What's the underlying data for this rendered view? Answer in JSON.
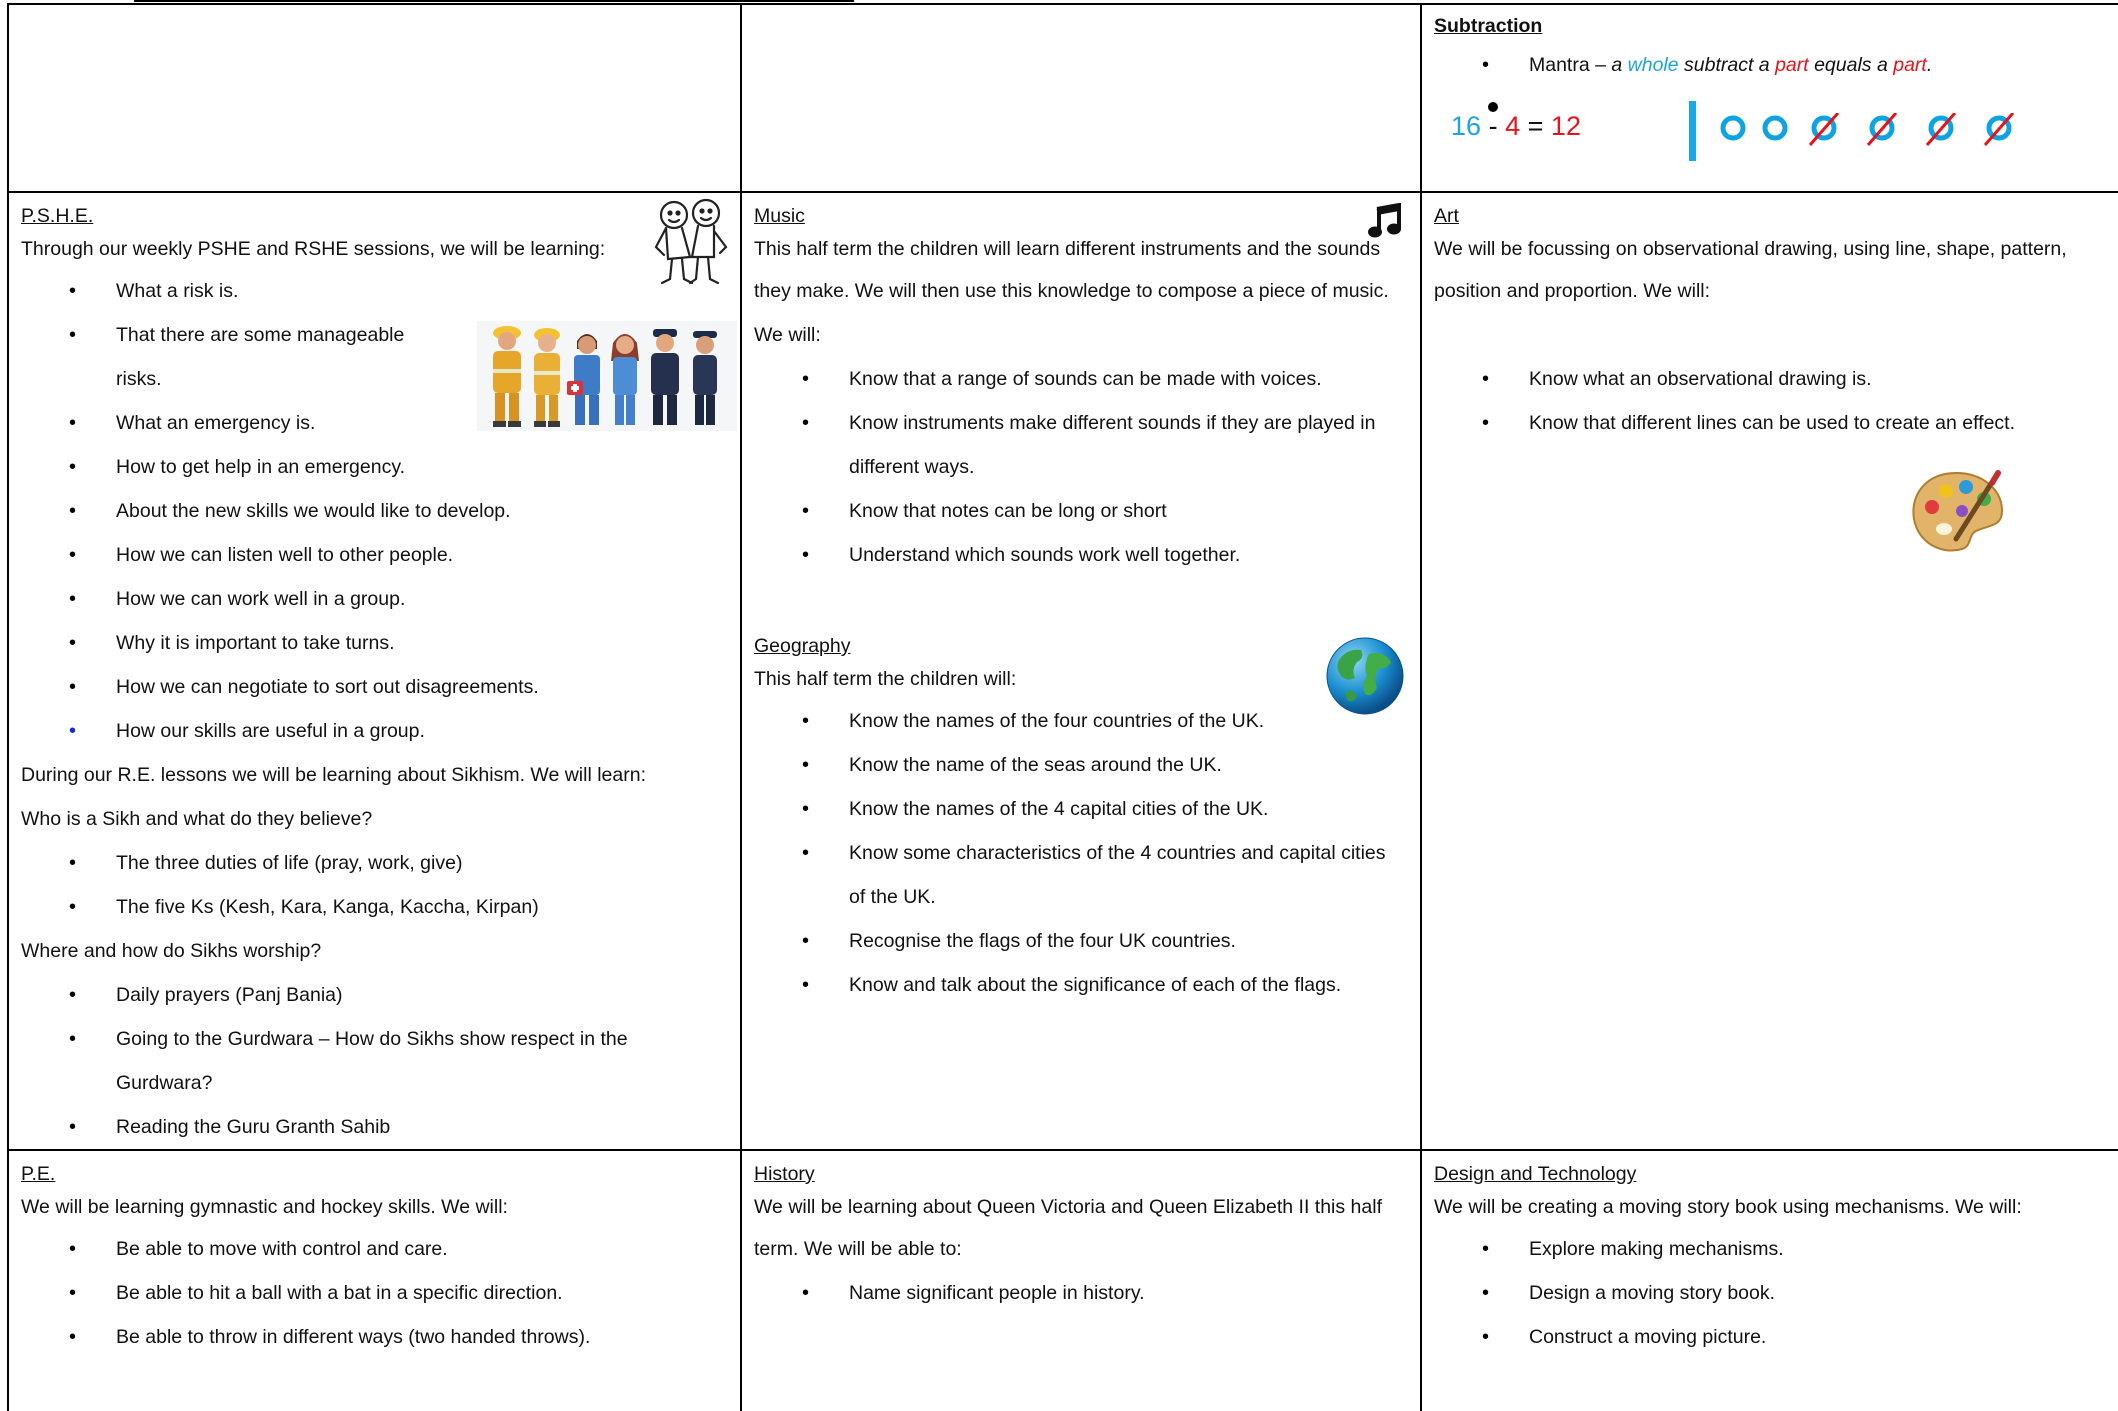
{
  "maths": {
    "title": "Subtraction",
    "mantra_prefix": "Mantra – ",
    "mantra_a": "a ",
    "mantra_whole": "whole",
    "mantra_subtract": " subtract a ",
    "mantra_part1": "part",
    "mantra_equals": " equals a ",
    "mantra_part2": "part",
    "mantra_end": ".",
    "eq_whole": "16",
    "eq_minus": "-",
    "eq_part": "4",
    "eq_equals": "=",
    "eq_result": "12",
    "colors": {
      "whole": "#1ba3dd",
      "part": "#e8131a",
      "bar": "#1aa7e6"
    },
    "model": {
      "kept": 2,
      "crossed": 4
    }
  },
  "pshe": {
    "title": "P.S.H.E.",
    "intro": "Through our weekly PSHE and RSHE sessions, we will be learning:",
    "items": [
      "What a risk is.",
      "That there are some manageable",
      "risks.",
      "What an emergency is.",
      "How to get help in an emergency.",
      "About the new skills we would like to develop.",
      "How we can listen well to other people.",
      "How we can work well in a group.",
      "Why it is important to take turns.",
      "How we can negotiate to sort out disagreements.",
      "How our skills are useful in a group."
    ],
    "re_intro": "During our R.E. lessons we will be learning about Sikhism. We will learn:",
    "q1": "Who is a Sikh and what do they believe?",
    "q1_items": [
      " The three duties of life (pray, work, give)",
      "The five Ks (Kesh, Kara, Kanga, Kaccha, Kirpan)"
    ],
    "q2": "Where and how do Sikhs worship?",
    "q2_items": [
      "Daily prayers (Panj Bania)",
      "Going to the Gurdwara – How do Sikhs show respect in the Gurdwara?",
      "Reading the Guru Granth Sahib"
    ],
    "icons": [
      "friends-drawing-icon",
      "helpers-illustration-icon"
    ]
  },
  "music": {
    "title": "Music",
    "intro1": "This half term the children will learn different instruments and the sounds",
    "intro2": "they make. We will then use this knowledge to compose a piece of music.",
    "intro3": "We will:",
    "items": [
      "Know that a range of sounds can be made with voices.",
      "Know instruments make different sounds if they are played in",
      "different ways.",
      "Know that notes can be long or short",
      "Understand which sounds work well together."
    ],
    "icon": "music-note-icon"
  },
  "geography": {
    "title": "Geography",
    "intro": "This half term the children will:",
    "items": [
      "Know the names of the four countries of the UK.",
      "Know the name of the seas around the UK.",
      "Know the names of the 4 capital cities of the UK.",
      "Know some characteristics of the 4 countries and capital cities",
      "of the UK.",
      "Recognise the flags of the four UK countries.",
      "Know and talk about the significance of each of the flags."
    ],
    "icon": "globe-icon"
  },
  "art": {
    "title": "Art",
    "intro1": "We will be focussing on observational drawing, using line, shape, pattern,",
    "intro2": "position and proportion. We will:",
    "items": [
      "Know what an observational drawing is.",
      "Know that different lines can be used to create an effect."
    ],
    "icon": "paint-palette-icon"
  },
  "pe": {
    "title": "P.E.",
    "intro": "We will be learning gymnastic and hockey skills. We will:",
    "items": [
      "Be able to move with control and care.",
      "Be able to hit a ball with a bat in a specific direction.",
      "Be able to throw in different ways (two handed throws)."
    ]
  },
  "history": {
    "title": "History",
    "intro1": "We will be learning about Queen Victoria and Queen Elizabeth II this half",
    "intro2": "term. We will be able to:",
    "items": [
      "Name significant people in history."
    ]
  },
  "dt": {
    "title": "Design and Technology",
    "intro": "We will be creating a moving story book using mechanisms. We will:",
    "items": [
      "Explore making mechanisms.",
      "Design a moving story book.",
      "Construct a moving picture."
    ]
  }
}
